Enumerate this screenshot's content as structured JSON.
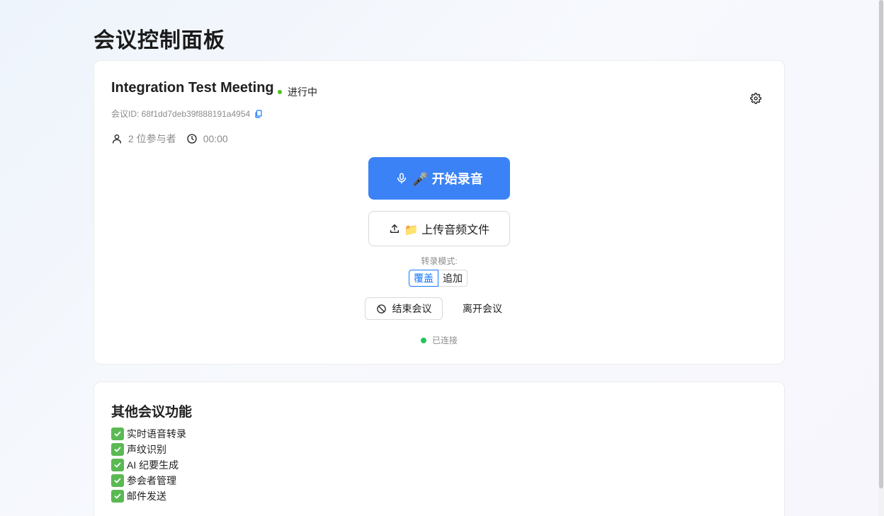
{
  "page": {
    "title": "会议控制面板"
  },
  "meeting": {
    "title": "Integration Test Meeting",
    "status": "进行中",
    "id_label": "会议ID: 68f1dd7deb39f888191a4954",
    "participants": "2 位参与者",
    "duration": "00:00",
    "record_label": "🎤 开始录音",
    "upload_label": "📁 上传音频文件",
    "mode_label": "转录模式:",
    "mode_options": [
      "覆盖",
      "追加"
    ],
    "mode_selected": "覆盖",
    "end_label": "结束会议",
    "leave_label": "离开会议",
    "connection": "已连接"
  },
  "features": {
    "title": "其他会议功能",
    "items": [
      "实时语音转录",
      "声纹识别",
      "AI 纪要生成",
      "参会者管理",
      "邮件发送"
    ]
  },
  "colors": {
    "primary": "#3b82f6",
    "status_green": "#52c41a",
    "connected_green": "#22c55e",
    "selected_blue": "#1677ff",
    "check_green": "#5ab953"
  },
  "icons": [
    "settings-icon",
    "copy-icon",
    "user-icon",
    "clock-icon",
    "microphone-icon",
    "upload-icon",
    "stop-icon",
    "check-icon"
  ]
}
